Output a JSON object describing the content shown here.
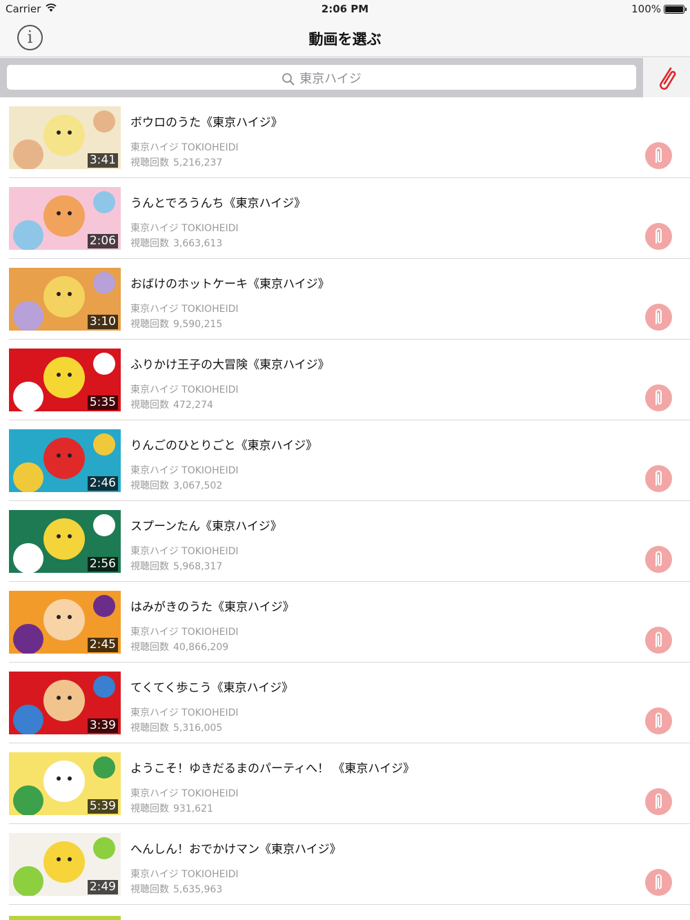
{
  "status": {
    "carrier": "Carrier",
    "time": "2:06 PM",
    "battery": "100%"
  },
  "nav": {
    "title": "動画を選ぶ",
    "info_label": "i"
  },
  "search": {
    "placeholder": "東京ハイジ"
  },
  "colors": {
    "accent": "#e0242b",
    "clip_circle": "#f2a6a6",
    "search_bg": "#c9c9ce"
  },
  "videos": [
    {
      "title": "ボウロのうた《東京ハイジ》",
      "channel": "東京ハイジ TOKIOHEIDI",
      "views_label": "視聴回数",
      "views": "5,216,237",
      "duration": "3:41",
      "thumb_colors": [
        "#f3e7c9",
        "#f6e48a",
        "#e7b489"
      ]
    },
    {
      "title": "うんとでろうんち《東京ハイジ》",
      "channel": "東京ハイジ TOKIOHEIDI",
      "views_label": "視聴回数",
      "views": "3,663,613",
      "duration": "2:06",
      "thumb_colors": [
        "#f6c6d8",
        "#f1a35c",
        "#8ec6e8"
      ]
    },
    {
      "title": "おばけのホットケーキ《東京ハイジ》",
      "channel": "東京ハイジ TOKIOHEIDI",
      "views_label": "視聴回数",
      "views": "9,590,215",
      "duration": "3:10",
      "thumb_colors": [
        "#e8a04a",
        "#f4d25f",
        "#b8a0d8"
      ]
    },
    {
      "title": "ふりかけ王子の大冒険《東京ハイジ》",
      "channel": "東京ハイジ TOKIOHEIDI",
      "views_label": "視聴回数",
      "views": "472,274",
      "duration": "5:35",
      "thumb_colors": [
        "#d8141d",
        "#f5d733",
        "#ffffff"
      ]
    },
    {
      "title": "りんごのひとりごと《東京ハイジ》",
      "channel": "東京ハイジ TOKIOHEIDI",
      "views_label": "視聴回数",
      "views": "3,067,502",
      "duration": "2:46",
      "thumb_colors": [
        "#27a8c9",
        "#e02a2a",
        "#f0c93a"
      ]
    },
    {
      "title": "スプーンたん《東京ハイジ》",
      "channel": "東京ハイジ TOKIOHEIDI",
      "views_label": "視聴回数",
      "views": "5,968,317",
      "duration": "2:56",
      "thumb_colors": [
        "#1e7a52",
        "#f3d43a",
        "#ffffff"
      ]
    },
    {
      "title": "はみがきのうた《東京ハイジ》",
      "channel": "東京ハイジ TOKIOHEIDI",
      "views_label": "視聴回数",
      "views": "40,866,209",
      "duration": "2:45",
      "thumb_colors": [
        "#f39b2a",
        "#f7d3a6",
        "#6b2d8a"
      ]
    },
    {
      "title": "てくてく歩こう《東京ハイジ》",
      "channel": "東京ハイジ TOKIOHEIDI",
      "views_label": "視聴回数",
      "views": "5,316,005",
      "duration": "3:39",
      "thumb_colors": [
        "#d7191f",
        "#f2c48d",
        "#3a7fd0"
      ]
    },
    {
      "title": "ようこそ！ゆきだるまのパーティへ！ 《東京ハイジ》",
      "channel": "東京ハイジ TOKIOHEIDI",
      "views_label": "視聴回数",
      "views": "931,621",
      "duration": "5:39",
      "thumb_colors": [
        "#f7e36a",
        "#ffffff",
        "#3da04a"
      ]
    },
    {
      "title": "へんしん！おでかけマン《東京ハイジ》",
      "channel": "東京ハイジ TOKIOHEIDI",
      "views_label": "視聴回数",
      "views": "5,635,963",
      "duration": "2:49",
      "thumb_colors": [
        "#f4f1ea",
        "#f6d43a",
        "#8ccf3f"
      ]
    }
  ]
}
